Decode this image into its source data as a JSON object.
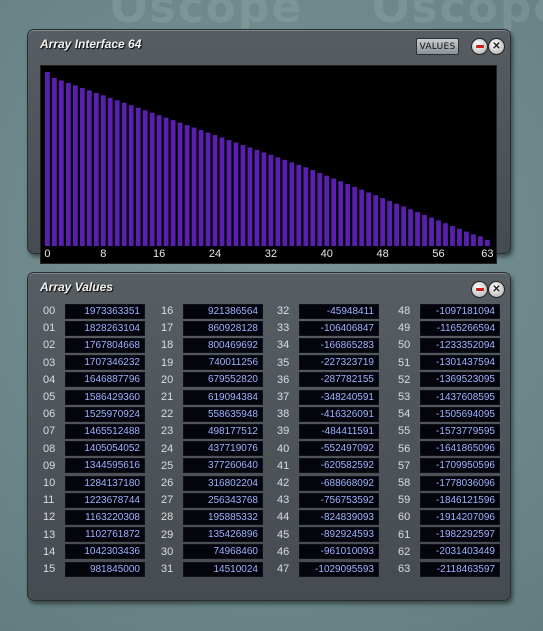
{
  "background": {
    "watermark": "Oscope",
    "color": "#6e8a8c"
  },
  "interface": {
    "title": "Array Interface 64",
    "values_button": "VALUES",
    "bar_color": "#5b1fb0",
    "x_ticks": [
      "0",
      "8",
      "16",
      "24",
      "32",
      "40",
      "48",
      "56",
      "63"
    ]
  },
  "array_values": {
    "title": "Array Values",
    "indices": [
      "00",
      "01",
      "02",
      "03",
      "04",
      "05",
      "06",
      "07",
      "08",
      "09",
      "10",
      "11",
      "12",
      "13",
      "14",
      "15",
      "16",
      "17",
      "18",
      "19",
      "20",
      "21",
      "22",
      "23",
      "24",
      "25",
      "26",
      "27",
      "28",
      "29",
      "30",
      "31",
      "32",
      "33",
      "34",
      "35",
      "36",
      "37",
      "38",
      "39",
      "40",
      "41",
      "42",
      "43",
      "44",
      "45",
      "46",
      "47",
      "48",
      "49",
      "50",
      "51",
      "52",
      "53",
      "54",
      "55",
      "56",
      "57",
      "58",
      "59",
      "60",
      "61",
      "62",
      "63"
    ],
    "values": [
      "1973363351",
      "1828263104",
      "1767804668",
      "1707346232",
      "1646887796",
      "1586429360",
      "1525970924",
      "1465512488",
      "1405054052",
      "1344595616",
      "1284137180",
      "1223678744",
      "1163220308",
      "1102761872",
      "1042303436",
      "981845000",
      "921386564",
      "860928128",
      "800469692",
      "740011256",
      "679552820",
      "619094384",
      "558635948",
      "498177512",
      "437719076",
      "377260640",
      "316802204",
      "256343768",
      "195885332",
      "135426896",
      "74968460",
      "14510024",
      "-45948411",
      "-106406847",
      "-166865283",
      "-227323719",
      "-287782155",
      "-348240591",
      "-416326091",
      "-484411591",
      "-552497092",
      "-620582592",
      "-688668092",
      "-756753592",
      "-824839093",
      "-892924593",
      "-961010093",
      "-1029095593",
      "-1097181094",
      "-1165266594",
      "-1233352094",
      "-1301437594",
      "-1369523095",
      "-1437608595",
      "-1505694095",
      "-1573779595",
      "-1641865096",
      "-1709950596",
      "-1778036096",
      "-1846121596",
      "-1914207096",
      "-1982292597",
      "-2031403449",
      "-2118463597"
    ]
  }
}
